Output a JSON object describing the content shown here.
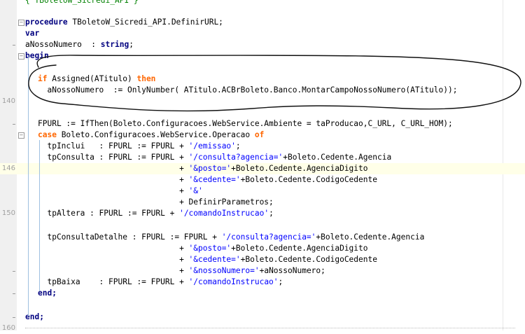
{
  "editor": {
    "header_comment": "{ TBoletoW_Sicredi_API }",
    "lines": [
      {
        "num": "",
        "text": ""
      },
      {
        "num": "",
        "text": "procedure TBoletoW_Sicredi_API.DefinirURL;"
      },
      {
        "num": "",
        "text": "var"
      },
      {
        "num": "",
        "text": "aNossoNumero  : string;"
      },
      {
        "num": "",
        "text": "begin"
      },
      {
        "num": "",
        "text": ""
      },
      {
        "num": "",
        "text": "if Assigned(ATitulo) then"
      },
      {
        "num": "",
        "text": "  aNossoNumero  := OnlyNumber( ATitulo.ACBrBoleto.Banco.MontarCampoNossoNumero(ATitulo));"
      },
      {
        "num": "140",
        "text": ""
      },
      {
        "num": "",
        "text": ""
      },
      {
        "num": "",
        "text": "FPURL := IfThen(Boleto.Configuracoes.WebService.Ambiente = taProducao,C_URL, C_URL_HOM);"
      },
      {
        "num": "",
        "text": "case Boleto.Configuracoes.WebService.Operacao of"
      },
      {
        "num": "",
        "text": "  tpInclui   : FPURL := FPURL + '/emissao';"
      },
      {
        "num": "",
        "text": "  tpConsulta : FPURL := FPURL + '/consulta?agencia='+Boleto.Cedente.Agencia"
      },
      {
        "num": "146",
        "text": "                              + '&posto='+Boleto.Cedente.AgenciaDigito"
      },
      {
        "num": "",
        "text": "                              + '&cedente='+Boleto.Cedente.CodigoCedente"
      },
      {
        "num": "",
        "text": "                              + '&'"
      },
      {
        "num": "",
        "text": "                              + DefinirParametros;"
      },
      {
        "num": "150",
        "text": "  tpAltera : FPURL := FPURL + '/comandoInstrucao';"
      },
      {
        "num": "",
        "text": ""
      },
      {
        "num": "",
        "text": "  tpConsultaDetalhe : FPURL := FPURL + '/consulta?agencia='+Boleto.Cedente.Agencia"
      },
      {
        "num": "",
        "text": "                              + '&posto='+Boleto.Cedente.AgenciaDigito"
      },
      {
        "num": "",
        "text": "                              + '&cedente='+Boleto.Cedente.CodigoCedente"
      },
      {
        "num": "",
        "text": "                              + '&nossoNumero='+aNossoNumero;"
      },
      {
        "num": "",
        "text": "  tpBaixa    : FPURL := FPURL + '/comandoInstrucao';"
      },
      {
        "num": "",
        "text": "end;"
      },
      {
        "num": "",
        "text": ""
      },
      {
        "num": "",
        "text": "end;"
      },
      {
        "num": "160",
        "text": ""
      }
    ]
  },
  "colors": {
    "keyword": "#000080",
    "keyword_orange": "#ff6600",
    "string": "#0000ff",
    "comment": "#008000",
    "current_line": "#ffffe8"
  },
  "icons": [
    "fold-minus-icon"
  ]
}
